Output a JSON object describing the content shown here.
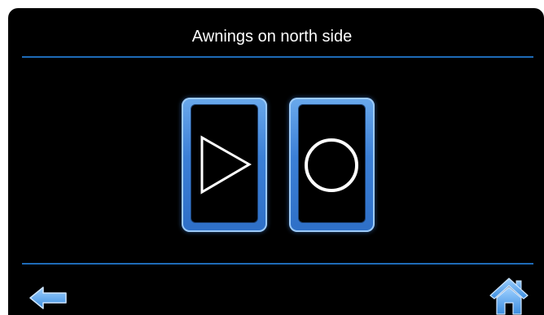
{
  "header": {
    "title": "Awnings on north side"
  },
  "controls": {
    "play_icon": "play-icon",
    "stop_icon": "stop-circle-icon"
  },
  "navigation": {
    "back_icon": "back-arrow-icon",
    "home_icon": "home-icon"
  },
  "colors": {
    "background": "#000000",
    "accent": "#3b7fd6",
    "divider": "#1e6bb8",
    "text": "#ffffff"
  }
}
